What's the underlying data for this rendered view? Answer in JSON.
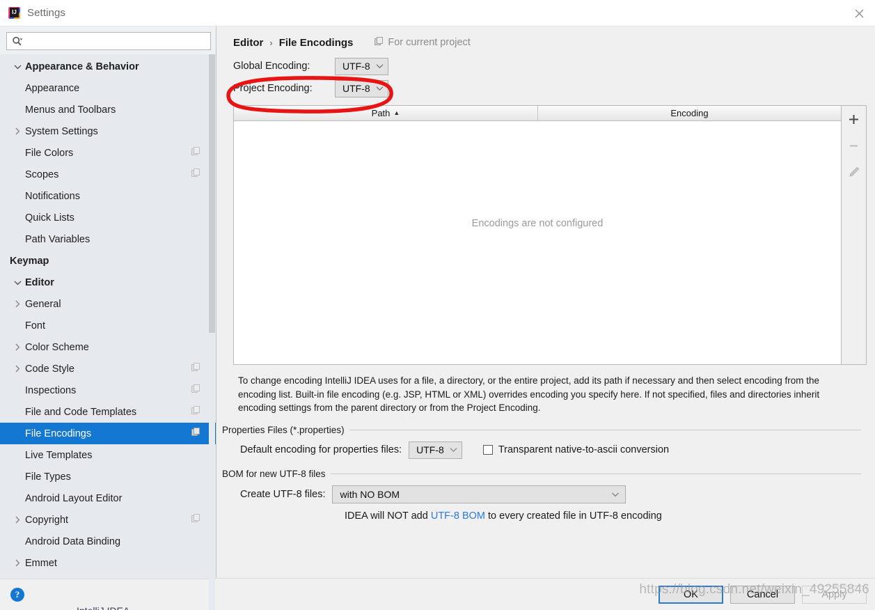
{
  "window": {
    "title": "Settings",
    "app_icon": "intellij-idea-icon",
    "close_icon": "close-icon"
  },
  "search": {
    "value": "",
    "placeholder": "",
    "icon": "search-icon"
  },
  "sidebar": {
    "items": [
      {
        "label": "Appearance & Behavior",
        "level": 0,
        "arrow": "chevron-down",
        "top": true,
        "copy": false,
        "selected": false
      },
      {
        "label": "Appearance",
        "level": 1,
        "arrow": "none",
        "top": false,
        "copy": false,
        "selected": false
      },
      {
        "label": "Menus and Toolbars",
        "level": 1,
        "arrow": "none",
        "top": false,
        "copy": false,
        "selected": false
      },
      {
        "label": "System Settings",
        "level": 1,
        "arrow": "chevron-right",
        "top": false,
        "copy": false,
        "selected": false
      },
      {
        "label": "File Colors",
        "level": 1,
        "arrow": "none",
        "top": false,
        "copy": true,
        "selected": false
      },
      {
        "label": "Scopes",
        "level": 1,
        "arrow": "none",
        "top": false,
        "copy": true,
        "selected": false
      },
      {
        "label": "Notifications",
        "level": 1,
        "arrow": "none",
        "top": false,
        "copy": false,
        "selected": false
      },
      {
        "label": "Quick Lists",
        "level": 1,
        "arrow": "none",
        "top": false,
        "copy": false,
        "selected": false
      },
      {
        "label": "Path Variables",
        "level": 1,
        "arrow": "none",
        "top": false,
        "copy": false,
        "selected": false
      },
      {
        "label": "Keymap",
        "level": 0,
        "arrow": "none",
        "top": true,
        "copy": false,
        "selected": false
      },
      {
        "label": "Editor",
        "level": 0,
        "arrow": "chevron-down",
        "top": true,
        "copy": false,
        "selected": false
      },
      {
        "label": "General",
        "level": 1,
        "arrow": "chevron-right",
        "top": false,
        "copy": false,
        "selected": false
      },
      {
        "label": "Font",
        "level": 1,
        "arrow": "none",
        "top": false,
        "copy": false,
        "selected": false
      },
      {
        "label": "Color Scheme",
        "level": 1,
        "arrow": "chevron-right",
        "top": false,
        "copy": false,
        "selected": false
      },
      {
        "label": "Code Style",
        "level": 1,
        "arrow": "chevron-right",
        "top": false,
        "copy": true,
        "selected": false
      },
      {
        "label": "Inspections",
        "level": 1,
        "arrow": "none",
        "top": false,
        "copy": true,
        "selected": false
      },
      {
        "label": "File and Code Templates",
        "level": 1,
        "arrow": "none",
        "top": false,
        "copy": true,
        "selected": false
      },
      {
        "label": "File Encodings",
        "level": 1,
        "arrow": "none",
        "top": false,
        "copy": true,
        "selected": true
      },
      {
        "label": "Live Templates",
        "level": 1,
        "arrow": "none",
        "top": false,
        "copy": false,
        "selected": false
      },
      {
        "label": "File Types",
        "level": 1,
        "arrow": "none",
        "top": false,
        "copy": false,
        "selected": false
      },
      {
        "label": "Android Layout Editor",
        "level": 1,
        "arrow": "none",
        "top": false,
        "copy": false,
        "selected": false
      },
      {
        "label": "Copyright",
        "level": 1,
        "arrow": "chevron-right",
        "top": false,
        "copy": true,
        "selected": false
      },
      {
        "label": "Android Data Binding",
        "level": 1,
        "arrow": "none",
        "top": false,
        "copy": false,
        "selected": false
      },
      {
        "label": "Emmet",
        "level": 1,
        "arrow": "chevron-right",
        "top": false,
        "copy": false,
        "selected": false
      }
    ],
    "help_button": "?"
  },
  "main": {
    "breadcrumb": {
      "parent": "Editor",
      "separator": "›",
      "current": "File Encodings",
      "scope_note": "For current project",
      "scope_icon": "copy-icon"
    },
    "global_encoding": {
      "label": "Global Encoding:",
      "value": "UTF-8"
    },
    "project_encoding": {
      "label": "Project Encoding:",
      "value": "UTF-8"
    },
    "table": {
      "columns": [
        "Path",
        "Encoding"
      ],
      "sort_column": "Path",
      "sort_direction": "▲",
      "rows": [],
      "empty_message": "Encodings are not configured",
      "toolbar": [
        {
          "name": "add-row-button",
          "glyph": "+"
        },
        {
          "name": "remove-row-button",
          "glyph": "−"
        },
        {
          "name": "edit-row-button",
          "glyph": "pencil"
        }
      ]
    },
    "description": "To change encoding IntelliJ IDEA uses for a file, a directory, or the entire project, add its path if necessary and then select encoding from the encoding list. Built-in file encoding (e.g. JSP, HTML or XML) overrides encoding you specify here. If not specified, files and directories inherit encoding settings from the parent directory or from the Project Encoding.",
    "properties_section": {
      "title": "Properties Files (*.properties)",
      "default_encoding_label": "Default encoding for properties files:",
      "default_encoding_value": "UTF-8",
      "checkbox_label": "Transparent native-to-ascii conversion",
      "checkbox_checked": false
    },
    "bom_section": {
      "title": "BOM for new UTF-8 files",
      "create_label": "Create UTF-8 files:",
      "create_value": "with NO BOM",
      "note_prefix": "IDEA will NOT add ",
      "note_link": "UTF-8 BOM",
      "note_suffix": " to every created file in UTF-8 encoding"
    }
  },
  "footer": {
    "ok": "OK",
    "cancel": "Cancel",
    "apply": "Apply"
  },
  "overlay": {
    "watermark": "https://blog.csdn.net/weixin_49255846",
    "annotation": "red-ellipse-highlight"
  },
  "colors": {
    "selection_blue": "#1477d1",
    "link_blue": "#2a7ae0",
    "annotation_red": "#e81414",
    "sidebar_bg": "#e6eaef",
    "panel_bg": "#f0f0f0"
  }
}
